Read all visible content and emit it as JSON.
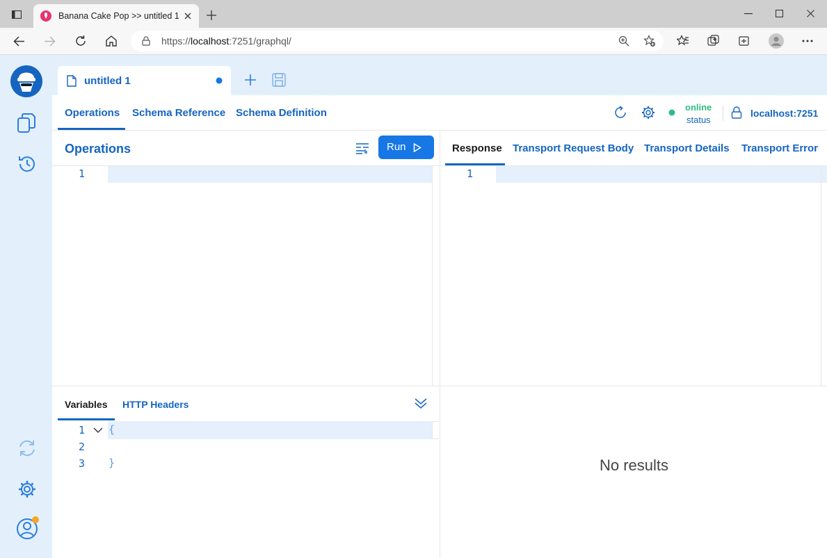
{
  "browser": {
    "tab_title": "Banana Cake Pop >> untitled 1",
    "url_prefix": "https://",
    "url_host": "localhost",
    "url_rest": ":7251/graphql/"
  },
  "app": {
    "document_tab": "untitled 1",
    "nav_tabs": [
      "Operations",
      "Schema Reference",
      "Schema Definition"
    ],
    "status_value": "online",
    "status_label": "status",
    "endpoint": "localhost:7251",
    "operations_title": "Operations",
    "run_label": "Run",
    "response_tabs": [
      "Response",
      "Transport Request Body",
      "Transport Details",
      "Transport Error"
    ],
    "operations_line_numbers": [
      "1"
    ],
    "response_line_numbers": [
      "1"
    ],
    "bottom_tabs": [
      "Variables",
      "HTTP Headers"
    ],
    "variables_line_numbers": [
      "1",
      "2",
      "3"
    ],
    "variables_code": [
      "{",
      "",
      "}"
    ],
    "no_results": "No results"
  },
  "colors": {
    "accent": "#1565c0",
    "run_button": "#1677e5",
    "online": "#2ebd80",
    "notification_dot": "#f5a623"
  }
}
